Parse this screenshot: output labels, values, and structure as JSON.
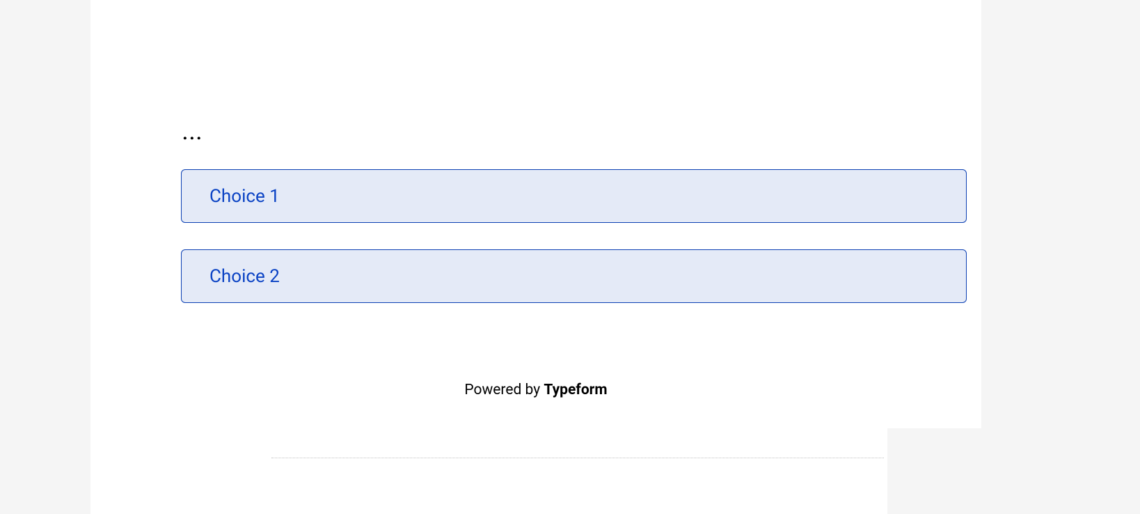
{
  "question": {
    "label": "..."
  },
  "choices": [
    {
      "label": "Choice 1"
    },
    {
      "label": "Choice 2"
    }
  ],
  "footer": {
    "prefix": "Powered by ",
    "brand": "Typeform"
  }
}
